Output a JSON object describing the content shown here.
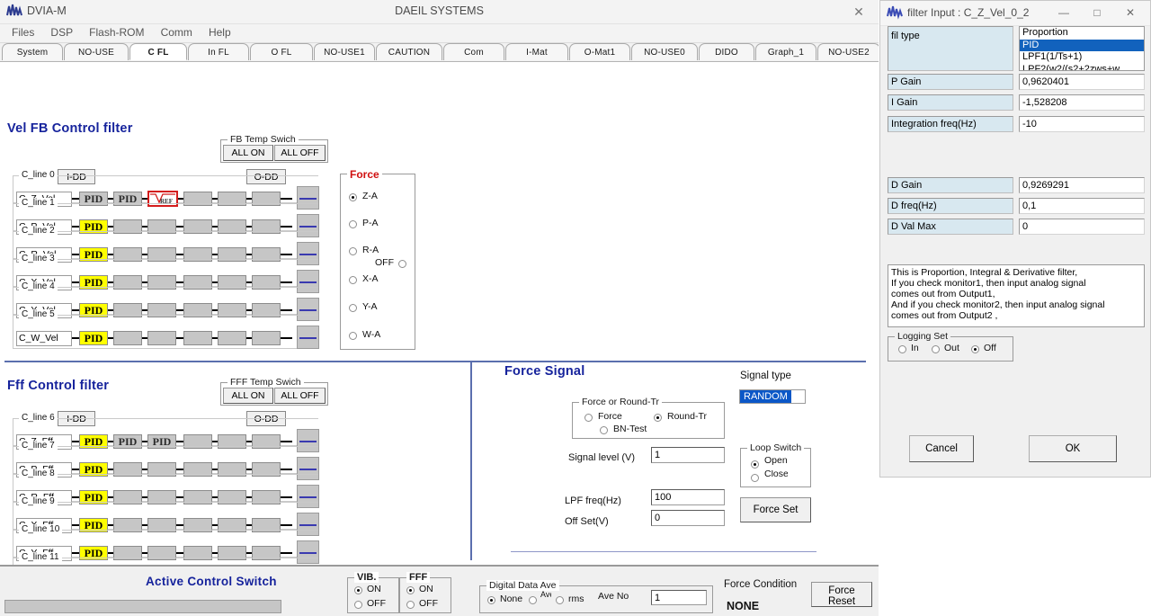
{
  "app": {
    "title": "DVIA-M",
    "center_title": "DAEIL SYSTEMS",
    "close_glyph": "✕",
    "menus": [
      "Files",
      "DSP",
      "Flash-ROM",
      "Comm",
      "Help"
    ],
    "tabs": [
      {
        "label": "System",
        "active": false
      },
      {
        "label": "NO-USE",
        "active": false
      },
      {
        "label": "C FL",
        "active": true
      },
      {
        "label": "In FL",
        "active": false
      },
      {
        "label": "O FL",
        "active": false
      },
      {
        "label": "NO-USE1",
        "active": false
      },
      {
        "label": "CAUTION",
        "active": false
      },
      {
        "label": "Com",
        "active": false
      },
      {
        "label": "I-Mat",
        "active": false
      },
      {
        "label": "O-Mat1",
        "active": false
      },
      {
        "label": "NO-USE0",
        "active": false
      },
      {
        "label": "DIDO",
        "active": false
      },
      {
        "label": "Graph_1",
        "active": false
      },
      {
        "label": "NO-USE2",
        "active": false
      }
    ]
  },
  "vel_fb": {
    "section_title": "Vel FB Control filter",
    "temp_switch": {
      "caption": "FB Temp Swich",
      "all_on": "ALL ON",
      "all_off": "ALL OFF"
    },
    "idd_label": "I-DD",
    "odd_label": "O-DD",
    "rows": [
      {
        "line": "C_line 0",
        "name": "C_Z_Vel",
        "blocks": [
          "PID",
          "PID",
          "VREF",
          "",
          "",
          "",
          ""
        ],
        "styles": [
          "pid-g",
          "pid-g",
          "vref",
          "empty",
          "empty",
          "empty",
          "empty"
        ]
      },
      {
        "line": "C_line 1",
        "name": "C_P_Vel",
        "blocks": [
          "PID",
          "",
          "",
          "",
          "",
          "",
          ""
        ],
        "styles": [
          "pid-y",
          "empty",
          "empty",
          "empty",
          "empty",
          "empty",
          "empty"
        ]
      },
      {
        "line": "C_line 2",
        "name": "C_R_Vel",
        "blocks": [
          "PID",
          "",
          "",
          "",
          "",
          "",
          ""
        ],
        "styles": [
          "pid-y",
          "empty",
          "empty",
          "empty",
          "empty",
          "empty",
          "empty"
        ]
      },
      {
        "line": "C_line 3",
        "name": "C_X_Vel",
        "blocks": [
          "PID",
          "",
          "",
          "",
          "",
          "",
          ""
        ],
        "styles": [
          "pid-y",
          "empty",
          "empty",
          "empty",
          "empty",
          "empty",
          "empty"
        ]
      },
      {
        "line": "C_line 4",
        "name": "C_Y_Vel",
        "blocks": [
          "PID",
          "",
          "",
          "",
          "",
          "",
          ""
        ],
        "styles": [
          "pid-y",
          "empty",
          "empty",
          "empty",
          "empty",
          "empty",
          "empty"
        ]
      },
      {
        "line": "C_line 5",
        "name": "C_W_Vel",
        "blocks": [
          "PID",
          "",
          "",
          "",
          "",
          "",
          ""
        ],
        "styles": [
          "pid-y",
          "empty",
          "empty",
          "empty",
          "empty",
          "empty",
          "empty"
        ]
      }
    ]
  },
  "force_group": {
    "caption": "Force",
    "options": [
      {
        "label": "Z-A",
        "selected": true
      },
      {
        "label": "P-A",
        "selected": false
      },
      {
        "label": "R-A",
        "selected": false
      },
      {
        "label": "X-A",
        "selected": false
      },
      {
        "label": "Y-A",
        "selected": false
      },
      {
        "label": "W-A",
        "selected": false
      }
    ],
    "off_label": "OFF",
    "off_selected": false
  },
  "fff": {
    "section_title": "Fff Control filter",
    "temp_switch": {
      "caption": "FFF Temp Swich",
      "all_on": "ALL ON",
      "all_off": "ALL OFF"
    },
    "idd_label": "I-DD",
    "odd_label": "O-DD",
    "rows": [
      {
        "line": "C_line 6",
        "name": "C_Z_Fff",
        "blocks": [
          "PID",
          "PID",
          "PID",
          "",
          "",
          "",
          ""
        ],
        "styles": [
          "pid-y",
          "pid-g",
          "pid-g",
          "empty",
          "empty",
          "empty",
          "empty"
        ]
      },
      {
        "line": "C_line 7",
        "name": "C_P_Fff",
        "blocks": [
          "PID",
          "",
          "",
          "",
          "",
          "",
          ""
        ],
        "styles": [
          "pid-y",
          "empty",
          "empty",
          "empty",
          "empty",
          "empty",
          "empty"
        ]
      },
      {
        "line": "C_line 8",
        "name": "C_R_Fff",
        "blocks": [
          "PID",
          "",
          "",
          "",
          "",
          "",
          ""
        ],
        "styles": [
          "pid-y",
          "empty",
          "empty",
          "empty",
          "empty",
          "empty",
          "empty"
        ]
      },
      {
        "line": "C_line 9",
        "name": "C_X_Fff",
        "blocks": [
          "PID",
          "",
          "",
          "",
          "",
          "",
          ""
        ],
        "styles": [
          "pid-y",
          "empty",
          "empty",
          "empty",
          "empty",
          "empty",
          "empty"
        ]
      },
      {
        "line": "C_line 10",
        "name": "C_Y_Fff",
        "blocks": [
          "PID",
          "",
          "",
          "",
          "",
          "",
          ""
        ],
        "styles": [
          "pid-y",
          "empty",
          "empty",
          "empty",
          "empty",
          "empty",
          "empty"
        ]
      },
      {
        "line": "C_line 11",
        "name": "C_W_Fff",
        "blocks": [
          "PID",
          "",
          "",
          "",
          "",
          "",
          ""
        ],
        "styles": [
          "pid-y",
          "empty",
          "empty",
          "empty",
          "empty",
          "empty",
          "empty"
        ]
      }
    ]
  },
  "force_signal": {
    "section_title": "Force Signal",
    "mode_group": {
      "caption": "Force or Round-Tr",
      "force": {
        "label": "Force",
        "selected": false
      },
      "round_tr": {
        "label": "Round-Tr",
        "selected": true
      },
      "bn_test": {
        "label": "BN-Test",
        "selected": false
      }
    },
    "signal_level_label": "Signal level (V)",
    "signal_level_value": "1",
    "lpf_label": "LPF freq(Hz)",
    "lpf_value": "100",
    "offset_label": "Off Set(V)",
    "offset_value": "0",
    "signal_type_label": "Signal type",
    "signal_type_value": "RANDOM",
    "loop_switch": {
      "caption": "Loop Switch",
      "open": {
        "label": "Open",
        "selected": true
      },
      "close": {
        "label": "Close",
        "selected": false
      }
    },
    "force_set_button": "Force Set"
  },
  "status": {
    "active_control_switch": "Active Control Switch",
    "vib": {
      "caption": "VIB.",
      "on": "ON",
      "off": "OFF",
      "on_selected": true
    },
    "fff": {
      "caption": "FFF",
      "on": "ON",
      "off": "OFF",
      "on_selected": true
    },
    "digital_data_ave": {
      "caption": "Digital Data Ave",
      "none": {
        "label": "None",
        "selected": true
      },
      "ave": {
        "label": "Ave",
        "selected": false
      },
      "rms": {
        "label": "rms",
        "selected": false
      },
      "ave_no_label": "Ave No",
      "ave_no_value": "1"
    },
    "force_condition_label": "Force Condition",
    "force_condition_value": "NONE",
    "force_reset_button": "Force\nReset"
  },
  "dialog": {
    "title": "filter Input : C_Z_Vel_0_2",
    "minimize_glyph": "—",
    "maximize_glyph": "□",
    "close_glyph": "✕",
    "fil_type_label": "fil type",
    "fil_type_options": [
      {
        "label": "Proportion",
        "selected": false
      },
      {
        "label": "PID",
        "selected": true
      },
      {
        "label": "LPF1(1/Ts+1)",
        "selected": false
      },
      {
        "label": "LPF2(w2/(s2+2zws+w",
        "selected": false
      }
    ],
    "fields": [
      {
        "label": "P Gain",
        "value": "0,9620401"
      },
      {
        "label": "I Gain",
        "value": "-1,528208"
      },
      {
        "label": "Integration freq(Hz)",
        "value": "-10"
      }
    ],
    "fields2": [
      {
        "label": "D Gain",
        "value": "0,9269291"
      },
      {
        "label": "D freq(Hz)",
        "value": "0,1"
      },
      {
        "label": "D Val Max",
        "value": "0"
      }
    ],
    "description": "This is Proportion, Integral & Derivative filter,\nIf you check monitor1, then input analog signal\ncomes out from Output1,\nAnd if you check monitor2, then input analog signal\ncomes out from Output2 ,",
    "logging_set": {
      "caption": "Logging Set",
      "in": {
        "label": "In",
        "selected": false
      },
      "out": {
        "label": "Out",
        "selected": false
      },
      "off": {
        "label": "Off",
        "selected": true
      }
    },
    "cancel_button": "Cancel",
    "ok_button": "OK"
  },
  "colors": {
    "accent_blue": "#16239c",
    "select_blue": "#1262bd",
    "highlight_yellow": "#ffff00",
    "red": "#d01010"
  }
}
